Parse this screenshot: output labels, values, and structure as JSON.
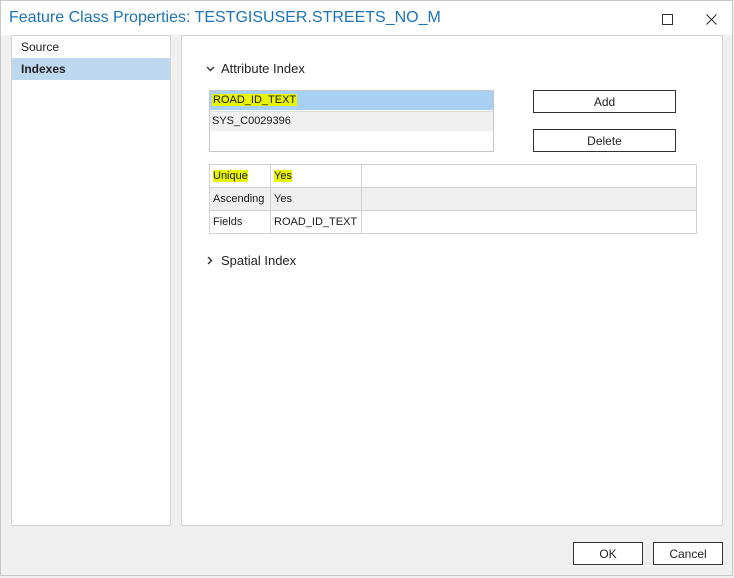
{
  "window": {
    "title": "Feature Class Properties: TESTGISUSER.STREETS_NO_M",
    "accent": "#1b73ba"
  },
  "sidebar": {
    "items": [
      {
        "label": "Source",
        "selected": false
      },
      {
        "label": "Indexes",
        "selected": true
      }
    ]
  },
  "attribute_index": {
    "header": "Attribute Index",
    "indexes": [
      "ROAD_ID_TEXT",
      "SYS_C0029396"
    ],
    "add_label": "Add",
    "delete_label": "Delete",
    "properties": [
      {
        "name": "Unique",
        "value": "Yes"
      },
      {
        "name": "Ascending",
        "value": "Yes"
      },
      {
        "name": "Fields",
        "value": "ROAD_ID_TEXT"
      }
    ]
  },
  "spatial_index": {
    "header": "Spatial Index"
  },
  "footer": {
    "ok_label": "OK",
    "cancel_label": "Cancel"
  },
  "colors": {
    "highlight": "#e8f500",
    "selection": "#a7d0f3"
  }
}
